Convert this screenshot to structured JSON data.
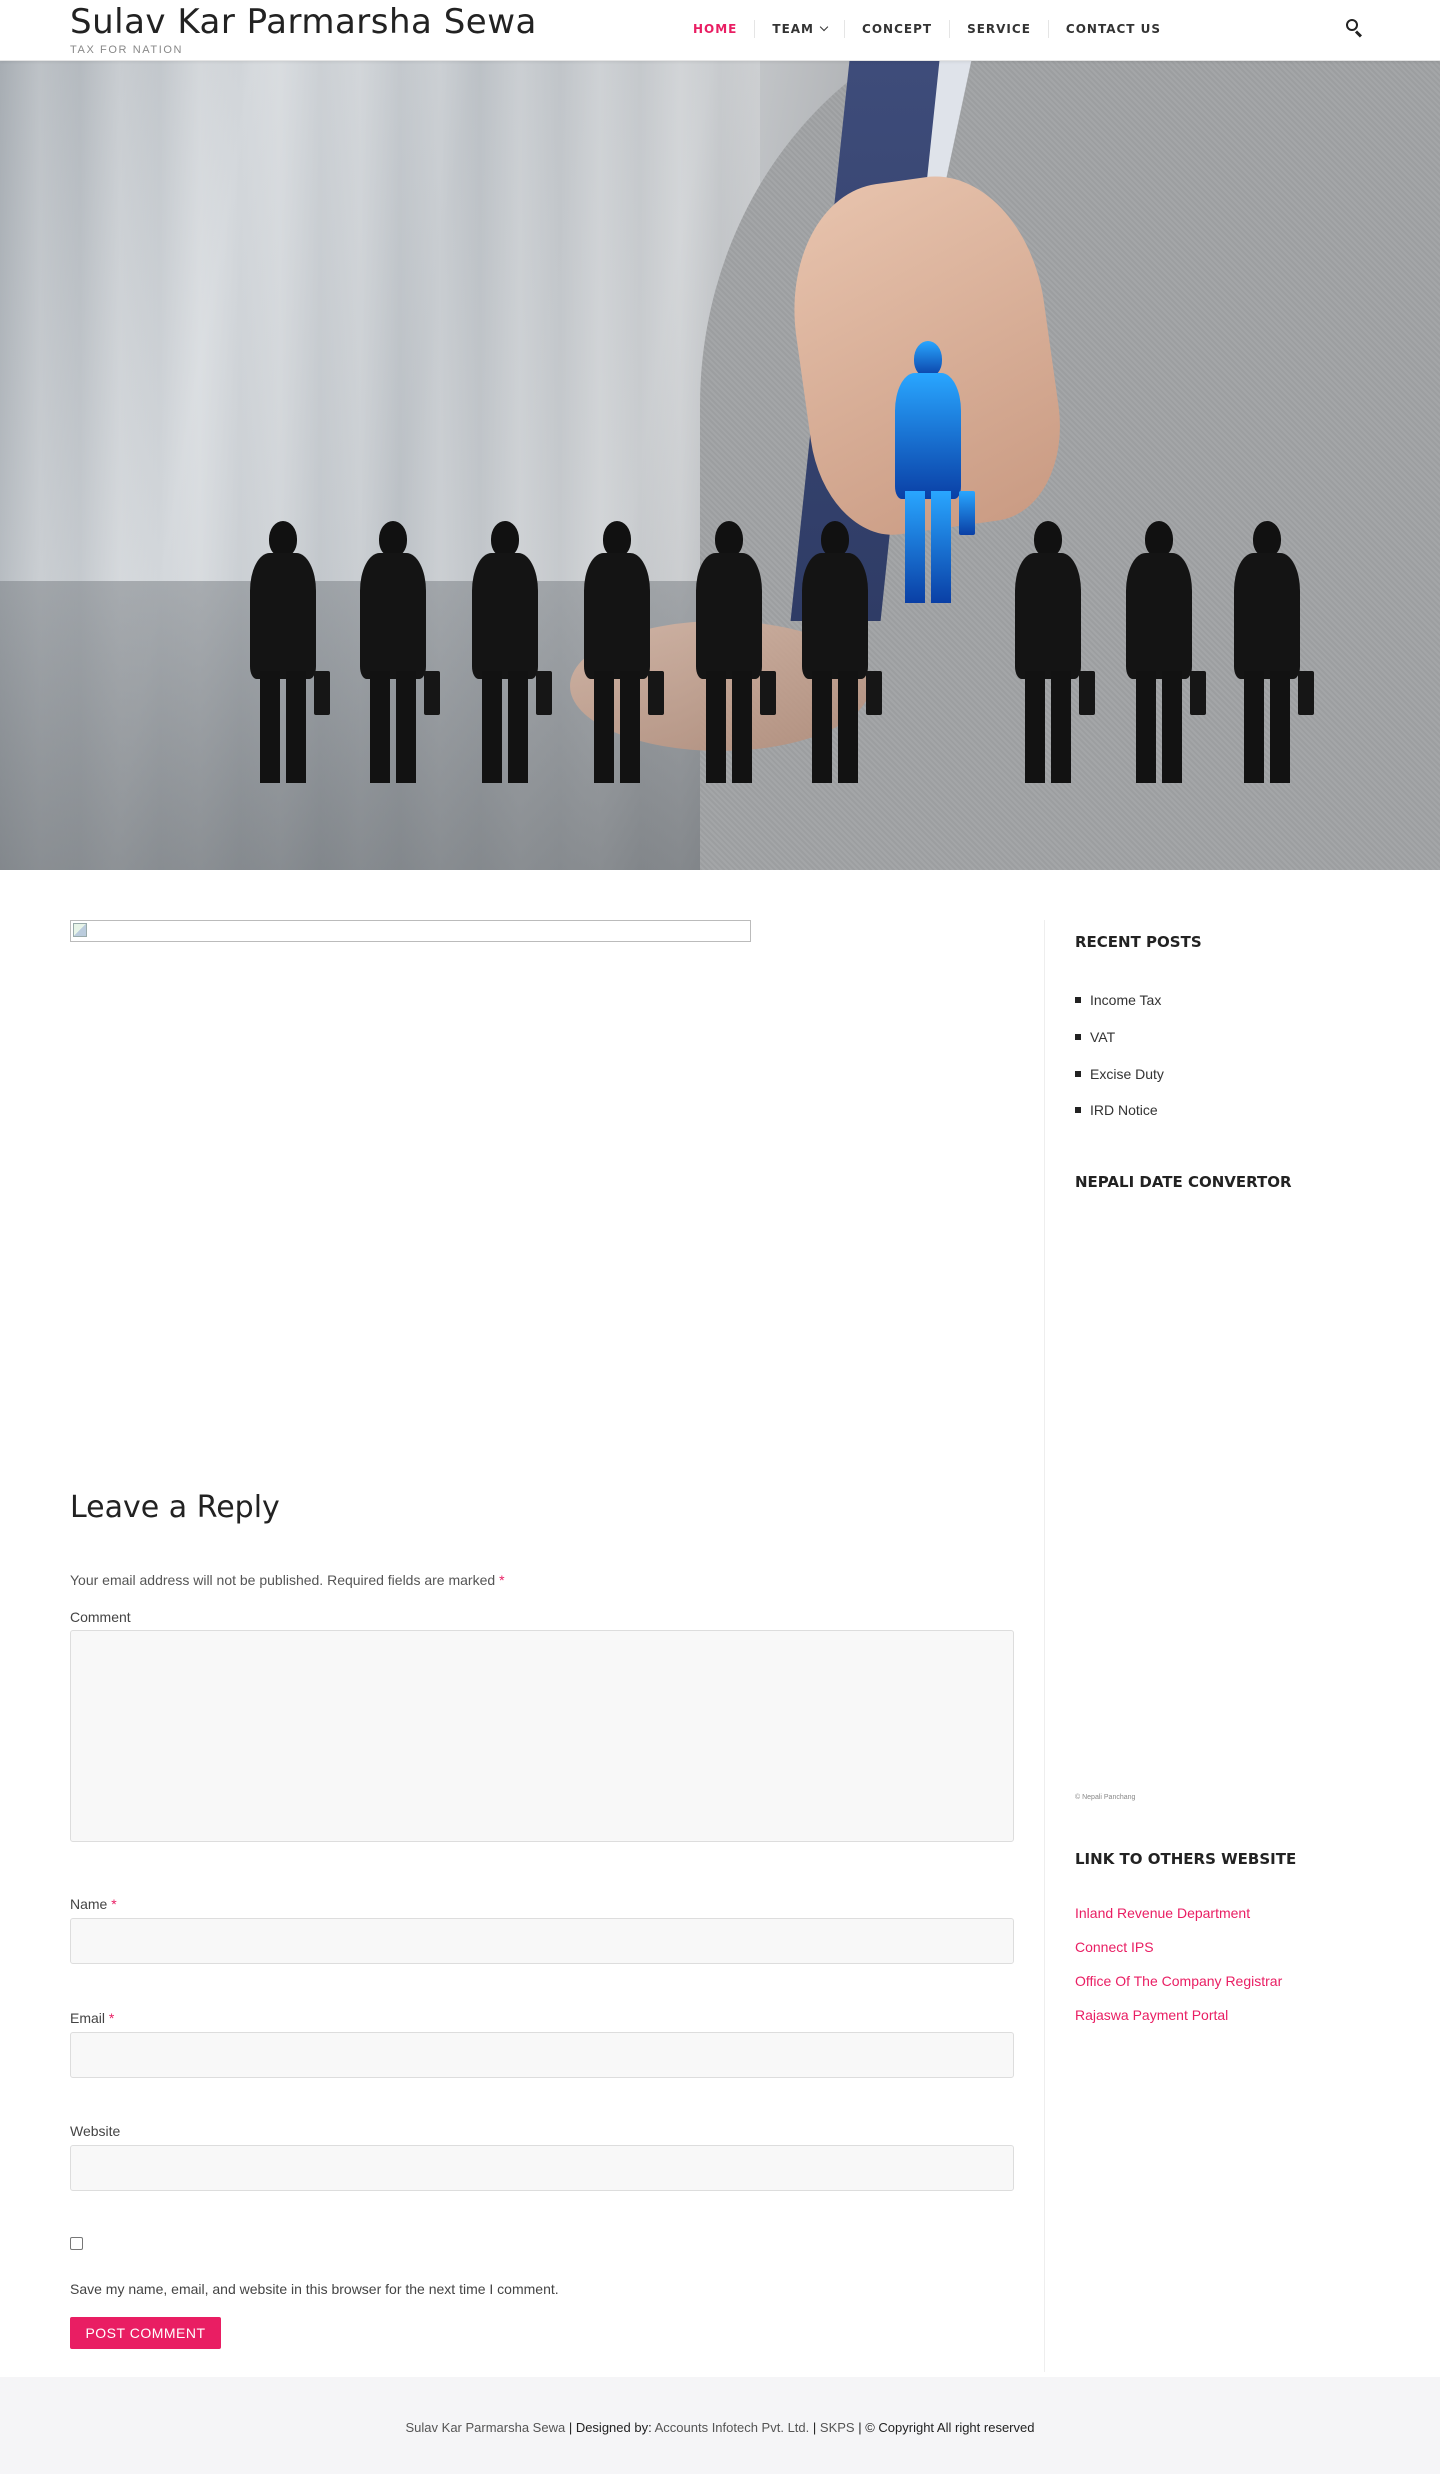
{
  "header": {
    "site_title": "Sulav Kar Parmarsha Sewa",
    "tagline": "TAX FOR NATION",
    "nav": [
      {
        "label": "HOME",
        "active": true
      },
      {
        "label": "TEAM",
        "has_dropdown": true
      },
      {
        "label": "CONCEPT"
      },
      {
        "label": "SERVICE"
      },
      {
        "label": "CONTACT US"
      }
    ],
    "search_icon": "search-icon"
  },
  "comment_form": {
    "title": "Leave a Reply",
    "notes": "Your email address will not be published. Required fields are marked",
    "required_mark": "*",
    "comment_label": "Comment",
    "name_label": "Name",
    "email_label": "Email",
    "website_label": "Website",
    "comment_value": "",
    "name_value": "",
    "email_value": "",
    "website_value": "",
    "cookies_checked": false,
    "cookies_label": "Save my name, email, and website in this browser for the next time I comment.",
    "submit_label": "POST COMMENT"
  },
  "sidebar": {
    "recent_posts_title": "RECENT POSTS",
    "recent_posts": [
      "Income Tax",
      "VAT",
      "Excise Duty",
      "IRD Notice"
    ],
    "date_convertor_title": "NEPALI DATE CONVERTOR",
    "date_convertor_credit": "© Nepali Panchang",
    "links_title": "LINK TO OTHERS WEBSITE",
    "links": [
      "Inland Revenue Department",
      "Connect IPS",
      "Office Of The Company Registrar",
      "Rajaswa Payment Portal"
    ]
  },
  "footer": {
    "site_name": "Sulav Kar Parmarsha Sewa",
    "designed_by_label": "| Designed by:",
    "designer": "Accounts Infotech Pvt. Ltd.",
    "separator": "|",
    "short_name": "SKPS",
    "copyright": "| © Copyright All right reserved"
  },
  "colors": {
    "accent": "#e91e63",
    "text": "#333333",
    "footer_bg": "#f5f5f7"
  }
}
